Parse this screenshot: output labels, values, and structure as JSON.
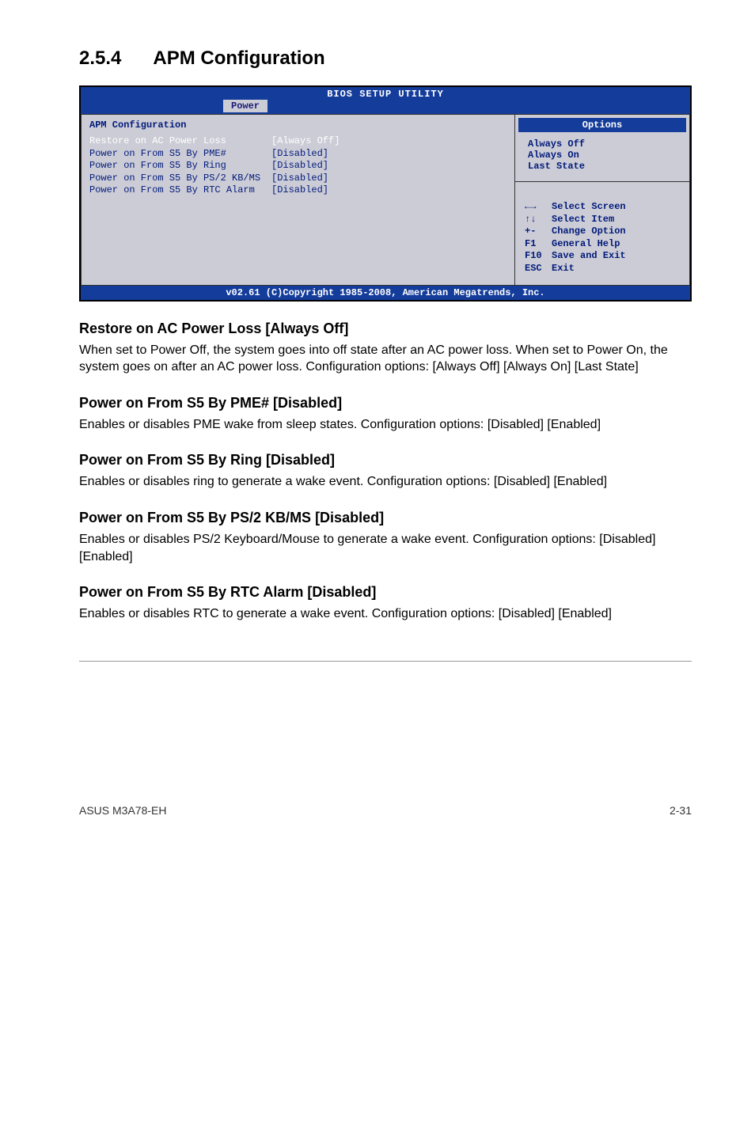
{
  "section": {
    "number": "2.5.4",
    "title": "APM Configuration"
  },
  "bios": {
    "header": "BIOS SETUP UTILITY",
    "tab": "Power",
    "left_title": "APM Configuration",
    "rows": [
      {
        "label": "Restore on AC Power Loss",
        "value": "[Always Off]",
        "highlighted": true
      },
      {
        "label": "Power on From S5 By PME#",
        "value": "[Disabled]",
        "highlighted": false
      },
      {
        "label": "Power on From S5 By Ring",
        "value": "[Disabled]",
        "highlighted": false
      },
      {
        "label": "Power on From S5 By PS/2 KB/MS",
        "value": "[Disabled]",
        "highlighted": false
      },
      {
        "label": "Power on From S5 By RTC Alarm",
        "value": "[Disabled]",
        "highlighted": false
      }
    ],
    "options_header": "Options",
    "options": [
      "Always Off",
      "Always On",
      "Last State"
    ],
    "help": [
      {
        "key": "←→",
        "text": "Select Screen"
      },
      {
        "key": "↑↓",
        "text": "Select Item"
      },
      {
        "key": "+-",
        "text": "Change Option"
      },
      {
        "key": "F1",
        "text": "General Help"
      },
      {
        "key": "F10",
        "text": "Save and Exit"
      },
      {
        "key": "ESC",
        "text": "Exit"
      }
    ],
    "footer": "v02.61 (C)Copyright 1985-2008, American Megatrends, Inc."
  },
  "content": [
    {
      "heading": "Restore on AC Power Loss [Always Off]",
      "paragraphs": [
        "When set to Power Off, the system goes into off state after an AC power loss. When set to Power On, the system goes on after an AC power loss. Configuration options: [Always Off] [Always On] [Last State]"
      ]
    },
    {
      "heading": "Power on From S5 By PME# [Disabled]",
      "paragraphs": [
        "Enables or disables PME wake from sleep states. Configuration options: [Disabled] [Enabled]"
      ]
    },
    {
      "heading": "Power on From S5 By Ring [Disabled]",
      "paragraphs": [
        "Enables or disables ring to generate a wake event. Configuration options: [Disabled] [Enabled]"
      ]
    },
    {
      "heading": "Power on From S5 By PS/2 KB/MS [Disabled]",
      "paragraphs": [
        "Enables or disables PS/2 Keyboard/Mouse to generate a wake event. Configuration options: [Disabled] [Enabled]"
      ]
    },
    {
      "heading": "Power on From S5 By RTC Alarm [Disabled]",
      "paragraphs": [
        "Enables or disables RTC to generate a wake event. Configuration options: [Disabled] [Enabled]"
      ]
    }
  ],
  "footer": {
    "left": "ASUS M3A78-EH",
    "right": "2-31"
  }
}
